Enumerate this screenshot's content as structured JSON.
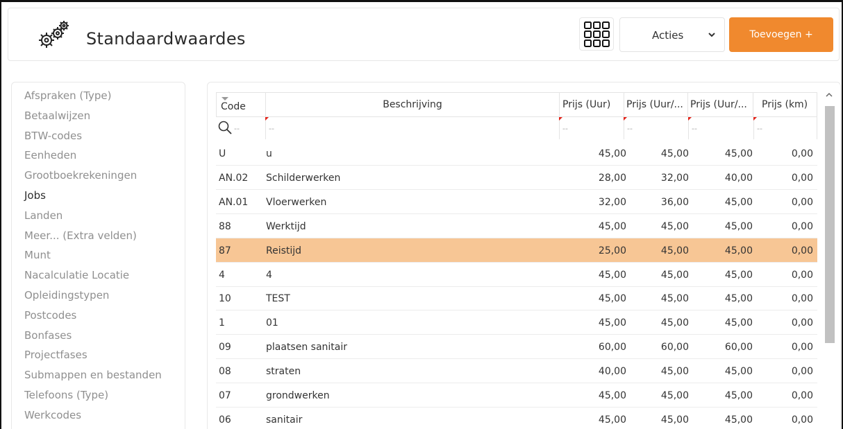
{
  "header": {
    "title": "Standaardwaardes",
    "actions_label": "Acties",
    "add_label": "Toevoegen +",
    "accent_color": "#f0892e"
  },
  "icons": [
    "gear-icon",
    "grid-icon",
    "chevron-down-icon",
    "search-icon",
    "scroll-up-icon"
  ],
  "sidebar": {
    "items": [
      {
        "label": "Afspraken (Type)"
      },
      {
        "label": "Betaalwijzen"
      },
      {
        "label": "BTW-codes"
      },
      {
        "label": "Eenheden"
      },
      {
        "label": "Grootboekrekeningen"
      },
      {
        "label": "Jobs",
        "active": true
      },
      {
        "label": "Landen"
      },
      {
        "label": "Meer... (Extra velden)"
      },
      {
        "label": "Munt"
      },
      {
        "label": "Nacalculatie Locatie"
      },
      {
        "label": "Opleidingstypen"
      },
      {
        "label": "Postcodes"
      },
      {
        "label": "Bonfases"
      },
      {
        "label": "Projectfases"
      },
      {
        "label": "Submappen en bestanden"
      },
      {
        "label": "Telefoons (Type)"
      },
      {
        "label": "Werkcodes"
      }
    ]
  },
  "table": {
    "columns": [
      "Code",
      "Beschrijving",
      "Prijs (Uur)",
      "Prijs (Uur/...",
      "Prijs (Uur/...",
      "Prijs (km)"
    ],
    "filter_placeholder": "--",
    "selected_row_color": "#f7c695",
    "rows": [
      {
        "code": "U",
        "desc": "u",
        "p1": "45,00",
        "p2": "45,00",
        "p3": "45,00",
        "km": "0,00"
      },
      {
        "code": "AN.02",
        "desc": "Schilderwerken",
        "p1": "28,00",
        "p2": "32,00",
        "p3": "40,00",
        "km": "0,00"
      },
      {
        "code": "AN.01",
        "desc": "Vloerwerken",
        "p1": "32,00",
        "p2": "36,00",
        "p3": "45,00",
        "km": "0,00"
      },
      {
        "code": "88",
        "desc": "Werktijd",
        "p1": "45,00",
        "p2": "45,00",
        "p3": "45,00",
        "km": "0,00"
      },
      {
        "code": "87",
        "desc": "Reistijd",
        "p1": "25,00",
        "p2": "45,00",
        "p3": "45,00",
        "km": "0,00",
        "selected": true
      },
      {
        "code": "4",
        "desc": "4",
        "p1": "45,00",
        "p2": "45,00",
        "p3": "45,00",
        "km": "0,00"
      },
      {
        "code": "10",
        "desc": "TEST",
        "p1": "45,00",
        "p2": "45,00",
        "p3": "45,00",
        "km": "0,00"
      },
      {
        "code": "1",
        "desc": "01",
        "p1": "45,00",
        "p2": "45,00",
        "p3": "45,00",
        "km": "0,00"
      },
      {
        "code": "09",
        "desc": "plaatsen sanitair",
        "p1": "60,00",
        "p2": "60,00",
        "p3": "60,00",
        "km": "0,00"
      },
      {
        "code": "08",
        "desc": "straten",
        "p1": "40,00",
        "p2": "45,00",
        "p3": "45,00",
        "km": "0,00"
      },
      {
        "code": "07",
        "desc": "grondwerken",
        "p1": "45,00",
        "p2": "45,00",
        "p3": "45,00",
        "km": "0,00"
      },
      {
        "code": "06",
        "desc": "sanitair",
        "p1": "45,00",
        "p2": "45,00",
        "p3": "45,00",
        "km": "0,00"
      }
    ]
  }
}
